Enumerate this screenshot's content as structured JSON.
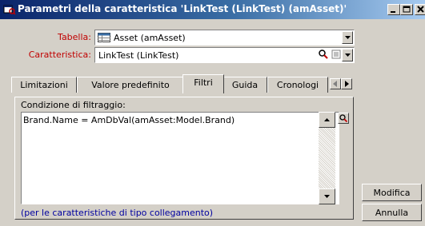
{
  "window": {
    "title": "Parametri della caratteristica 'LinkTest (LinkTest) (amAsset)'"
  },
  "form": {
    "table_label": "Tabella:",
    "table_value": "Asset (amAsset)",
    "feature_label": "Caratteristica:",
    "feature_value": "LinkTest (LinkTest)"
  },
  "tabs": [
    {
      "label": "Limitazioni",
      "active": false
    },
    {
      "label": "Valore predefinito",
      "active": false
    },
    {
      "label": "Filtri",
      "active": true
    },
    {
      "label": "Guida",
      "active": false
    },
    {
      "label": "Cronologi",
      "active": false
    }
  ],
  "filter": {
    "label": "Condizione di filtraggio:",
    "value": "Brand.Name = AmDbVal(amAsset:Model.Brand)",
    "note": "(per le caratteristiche di tipo collegamento)"
  },
  "buttons": {
    "modify": "Modifica",
    "cancel": "Annulla"
  },
  "colors": {
    "title_start": "#0a246a",
    "title_end": "#a6caf0",
    "label_red": "#c00000",
    "note_blue": "#0000a0",
    "face": "#d4d0c8"
  },
  "icons": [
    "window-app-icon",
    "minimize-icon",
    "maximize-icon",
    "close-icon",
    "table-icon",
    "magnifier-icon",
    "list-icon",
    "dropdown-arrow-icon",
    "tab-scroll-left-icon",
    "tab-scroll-right-icon"
  ]
}
